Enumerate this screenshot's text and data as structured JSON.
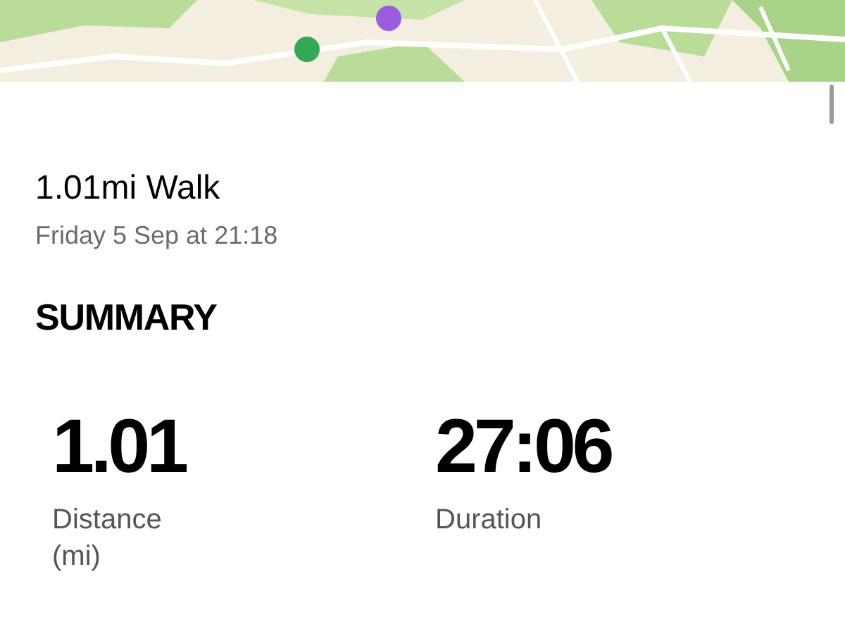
{
  "activity": {
    "title": "1.01mi Walk",
    "date": "Friday 5 Sep at 21:18"
  },
  "summary": {
    "heading": "SUMMARY",
    "stats": [
      {
        "value": "1.01",
        "label": "Distance (mi)"
      },
      {
        "value": "27:06",
        "label": "Duration"
      }
    ]
  }
}
